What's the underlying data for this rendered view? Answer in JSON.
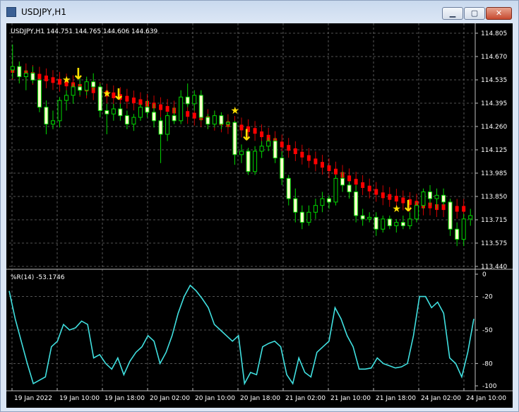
{
  "window": {
    "title": "USDJPY,H1",
    "minimize_label": "▁",
    "maximize_label": "▢",
    "close_label": "✕"
  },
  "chart": {
    "header": "USDJPY,H1  144.751 144.765 144.606 144.639",
    "price_ticks": [
      "114.805",
      "114.670",
      "114.535",
      "114.395",
      "114.260",
      "114.125",
      "113.985",
      "113.850",
      "113.715",
      "113.575",
      "113.440"
    ],
    "indicator_header": "%R(14) -53.1746",
    "indicator_ticks": [
      "0",
      "-20",
      "-50",
      "-80",
      "-100"
    ],
    "time_ticks": [
      "19 Jan 2022",
      "19 Jan 10:00",
      "19 Jan 18:00",
      "20 Jan 02:00",
      "20 Jan 10:00",
      "20 Jan 18:00",
      "21 Jan 02:00",
      "21 Jan 10:00",
      "21 Jan 18:00",
      "24 Jan 02:00",
      "24 Jan 10:00"
    ],
    "colors": {
      "background": "#000000",
      "grid": "#6e6e6e",
      "bull": "#00d800",
      "bull_body": "#ffffcc",
      "bear": "#00d800",
      "ma": "#ff0000",
      "signal": "#ffe000",
      "indicator": "#40e0e0",
      "current": "#00bfff"
    }
  },
  "chart_data": [
    {
      "type": "candlestick",
      "symbol": "USDJPY",
      "timeframe": "H1",
      "ylim": [
        113.44,
        114.85
      ],
      "current_bar": {
        "open": 144.751,
        "high": 144.765,
        "low": 144.606,
        "close": 144.639
      },
      "ohlc": [
        [
          114.6,
          114.75,
          114.55,
          114.62
        ],
        [
          114.62,
          114.65,
          114.52,
          114.56
        ],
        [
          114.56,
          114.6,
          114.48,
          114.58
        ],
        [
          114.58,
          114.62,
          114.52,
          114.54
        ],
        [
          114.54,
          114.55,
          114.35,
          114.38
        ],
        [
          114.38,
          114.42,
          114.22,
          114.28
        ],
        [
          114.28,
          114.36,
          114.25,
          114.3
        ],
        [
          114.3,
          114.44,
          114.26,
          114.42
        ],
        [
          114.42,
          114.48,
          114.36,
          114.45
        ],
        [
          114.45,
          114.52,
          114.4,
          114.5
        ],
        [
          114.5,
          114.55,
          114.45,
          114.48
        ],
        [
          114.48,
          114.56,
          114.45,
          114.53
        ],
        [
          114.53,
          114.58,
          114.48,
          114.5
        ],
        [
          114.5,
          114.52,
          114.32,
          114.36
        ],
        [
          114.36,
          114.4,
          114.22,
          114.34
        ],
        [
          114.34,
          114.4,
          114.3,
          114.37
        ],
        [
          114.37,
          114.4,
          114.3,
          114.33
        ],
        [
          114.33,
          114.36,
          114.25,
          114.28
        ],
        [
          114.28,
          114.34,
          114.24,
          114.32
        ],
        [
          114.32,
          114.4,
          114.3,
          114.38
        ],
        [
          114.38,
          114.42,
          114.32,
          114.35
        ],
        [
          114.35,
          114.4,
          114.26,
          114.3
        ],
        [
          114.3,
          114.32,
          114.05,
          114.22
        ],
        [
          114.22,
          114.35,
          114.18,
          114.33
        ],
        [
          114.33,
          114.38,
          114.28,
          114.3
        ],
        [
          114.3,
          114.48,
          114.28,
          114.44
        ],
        [
          114.44,
          114.52,
          114.38,
          114.4
        ],
        [
          114.4,
          114.48,
          114.36,
          114.45
        ],
        [
          114.45,
          114.48,
          114.3,
          114.32
        ],
        [
          114.32,
          114.34,
          114.25,
          114.28
        ],
        [
          114.28,
          114.36,
          114.26,
          114.33
        ],
        [
          114.33,
          114.35,
          114.25,
          114.28
        ],
        [
          114.28,
          114.3,
          114.26,
          114.29
        ],
        [
          114.29,
          114.3,
          114.04,
          114.1
        ],
        [
          114.1,
          114.16,
          114.05,
          114.12
        ],
        [
          114.12,
          114.14,
          113.98,
          114.0
        ],
        [
          114.0,
          114.15,
          113.98,
          114.12
        ],
        [
          114.12,
          114.18,
          114.08,
          114.15
        ],
        [
          114.15,
          114.2,
          114.12,
          114.18
        ],
        [
          114.18,
          114.2,
          114.05,
          114.08
        ],
        [
          114.08,
          114.12,
          113.92,
          113.96
        ],
        [
          113.96,
          113.98,
          113.8,
          113.84
        ],
        [
          113.84,
          113.9,
          113.7,
          113.76
        ],
        [
          113.76,
          113.8,
          113.66,
          113.7
        ],
        [
          113.7,
          113.8,
          113.68,
          113.76
        ],
        [
          113.76,
          113.84,
          113.72,
          113.8
        ],
        [
          113.8,
          113.88,
          113.76,
          113.84
        ],
        [
          113.84,
          113.86,
          113.78,
          113.82
        ],
        [
          113.82,
          113.98,
          113.8,
          113.96
        ],
        [
          113.96,
          114.0,
          113.88,
          113.92
        ],
        [
          113.92,
          113.94,
          113.84,
          113.88
        ],
        [
          113.88,
          113.92,
          113.7,
          113.74
        ],
        [
          113.74,
          113.78,
          113.68,
          113.72
        ],
        [
          113.72,
          113.76,
          113.7,
          113.73
        ],
        [
          113.73,
          113.76,
          113.62,
          113.66
        ],
        [
          113.66,
          113.74,
          113.64,
          113.72
        ],
        [
          113.72,
          113.74,
          113.66,
          113.68
        ],
        [
          113.68,
          113.72,
          113.64,
          113.7
        ],
        [
          113.7,
          113.74,
          113.66,
          113.68
        ],
        [
          113.68,
          113.76,
          113.66,
          113.72
        ],
        [
          113.72,
          113.82,
          113.7,
          113.8
        ],
        [
          113.8,
          113.9,
          113.78,
          113.88
        ],
        [
          113.88,
          113.92,
          113.8,
          113.84
        ],
        [
          113.84,
          113.9,
          113.78,
          113.86
        ],
        [
          113.86,
          113.9,
          113.8,
          113.82
        ],
        [
          113.82,
          113.84,
          113.62,
          113.66
        ],
        [
          113.66,
          113.7,
          113.56,
          113.6
        ],
        [
          113.6,
          113.75,
          113.56,
          113.72
        ],
        [
          113.72,
          113.78,
          113.68,
          113.74
        ]
      ],
      "ma": [
        114.6,
        114.59,
        114.58,
        114.57,
        114.56,
        114.55,
        114.54,
        114.53,
        114.52,
        114.51,
        114.5,
        114.49,
        114.48,
        114.47,
        114.46,
        114.45,
        114.44,
        114.43,
        114.42,
        114.41,
        114.4,
        114.39,
        114.38,
        114.37,
        114.36,
        114.35,
        114.34,
        114.33,
        114.32,
        114.31,
        114.3,
        114.29,
        114.28,
        114.27,
        114.26,
        114.25,
        114.24,
        114.22,
        114.2,
        114.18,
        114.16,
        114.14,
        114.12,
        114.1,
        114.08,
        114.06,
        114.04,
        114.02,
        114.0,
        113.98,
        113.96,
        113.94,
        113.92,
        113.9,
        113.88,
        113.86,
        113.85,
        113.84,
        113.83,
        113.82,
        113.81,
        113.8,
        113.8,
        113.79,
        113.79,
        113.78,
        113.78,
        113.78
      ],
      "signals_star": [
        8,
        14,
        33,
        57
      ],
      "signals_arrow": [
        9,
        15,
        34,
        58
      ]
    },
    {
      "type": "line",
      "name": "%R(14)",
      "ylim": [
        -100,
        0
      ],
      "values": [
        -15,
        -40,
        -60,
        -80,
        -98,
        -95,
        -92,
        -65,
        -60,
        -45,
        -50,
        -48,
        -42,
        -45,
        -75,
        -72,
        -80,
        -85,
        -75,
        -90,
        -78,
        -70,
        -65,
        -55,
        -60,
        -80,
        -70,
        -55,
        -35,
        -20,
        -10,
        -15,
        -22,
        -30,
        -45,
        -50,
        -55,
        -60,
        -55,
        -98,
        -88,
        -90,
        -65,
        -62,
        -60,
        -65,
        -90,
        -98,
        -75,
        -88,
        -92,
        -70,
        -65,
        -60,
        -30,
        -40,
        -55,
        -65,
        -85,
        -85,
        -84,
        -75,
        -80,
        -82,
        -84,
        -83,
        -80,
        -55,
        -20,
        -20,
        -30,
        -25,
        -35,
        -75,
        -80,
        -92,
        -70,
        -40
      ]
    }
  ]
}
